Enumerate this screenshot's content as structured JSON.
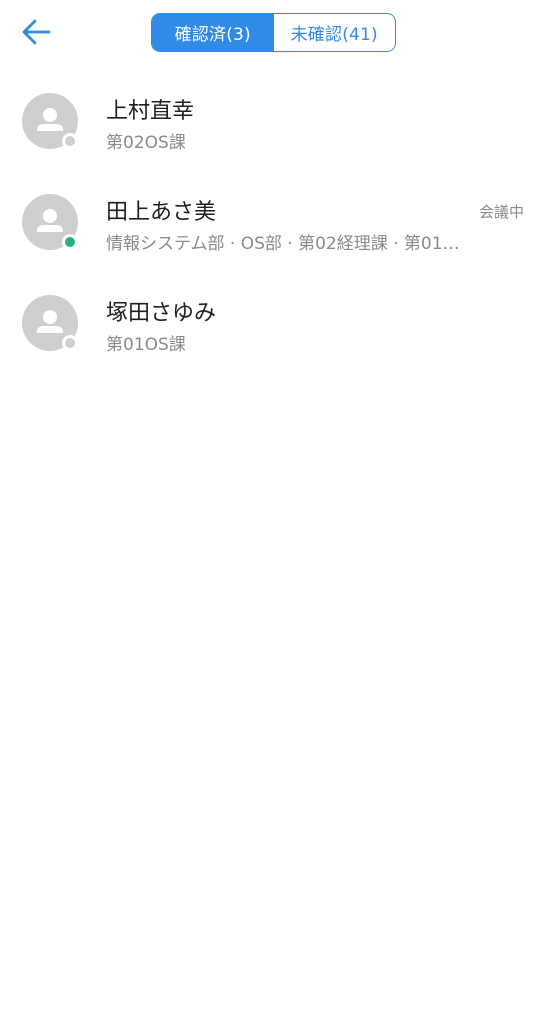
{
  "colors": {
    "accent": "#2f8be6",
    "avatar_bg": "#cfcfcf",
    "status_online": "#27b27a",
    "status_offline": "#cfcfcf",
    "text_primary": "#1f1f1f",
    "text_secondary": "#8a8a8a"
  },
  "header": {
    "back_icon": "arrow-left-icon",
    "tabs": [
      {
        "label": "確認済(3)",
        "active": true
      },
      {
        "label": "未確認(41)",
        "active": false
      }
    ]
  },
  "users": [
    {
      "name": "上村直幸",
      "department": "第02OS課",
      "presence": "",
      "status": "offline",
      "avatar_icon": "person-icon"
    },
    {
      "name": "田上あさ美",
      "department": "情報システム部 · OS部 · 第02経理課 · 第01…",
      "presence": "会議中",
      "status": "online",
      "avatar_icon": "person-icon"
    },
    {
      "name": "塚田さゆみ",
      "department": "第01OS課",
      "presence": "",
      "status": "offline",
      "avatar_icon": "person-icon"
    }
  ]
}
